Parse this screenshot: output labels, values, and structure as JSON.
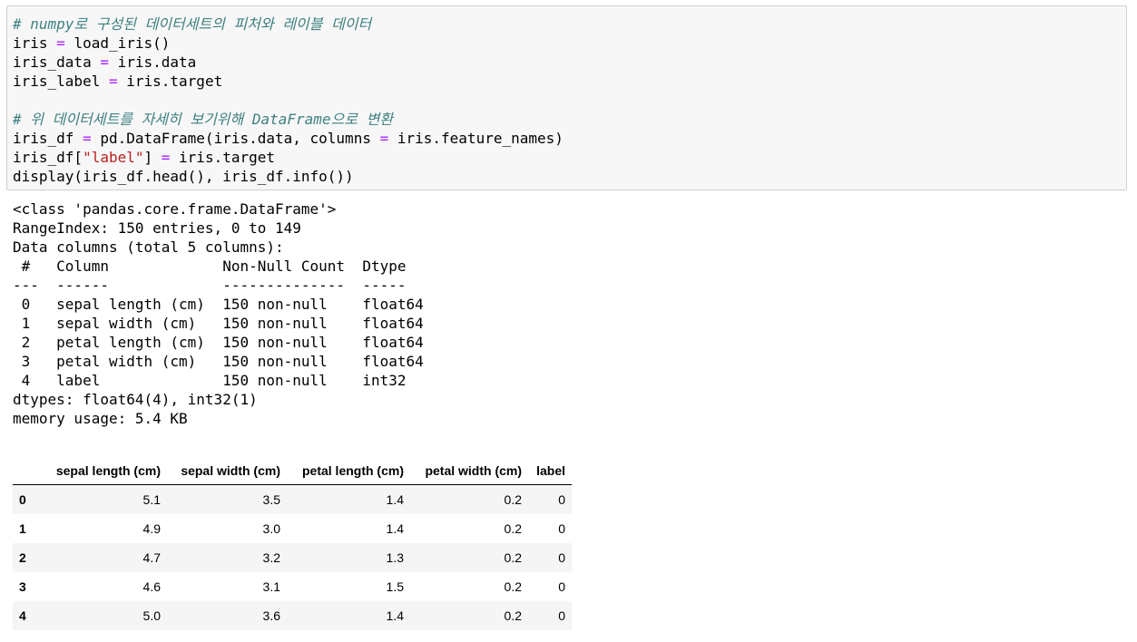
{
  "code_cell": {
    "lines": [
      {
        "comment": "# numpy로 구성된 데이터세트의 피처와 레이블 데이터"
      },
      {
        "a": "iris ",
        "op": "=",
        "b": " load_iris()"
      },
      {
        "a": "iris_data ",
        "op": "=",
        "b": " iris.data"
      },
      {
        "a": "iris_label ",
        "op": "=",
        "b": " iris.target"
      },
      {
        "comment": "# 위 데이터세트를 자세히 보기위해 DataFrame으로 변환"
      },
      {
        "a": "iris_df ",
        "op": "=",
        "b": " pd.DataFrame(iris.data, columns ",
        "op2": "=",
        "c": " iris.feature_names)"
      },
      {
        "a": "iris_df[",
        "str": "\"label\"",
        "b": "] ",
        "op": "=",
        "c": " iris.target"
      },
      {
        "text": "display(iris_df.head(), iris_df.info())"
      }
    ]
  },
  "output": {
    "info_lines": [
      "<class 'pandas.core.frame.DataFrame'>",
      "RangeIndex: 150 entries, 0 to 149",
      "Data columns (total 5 columns):",
      " #   Column             Non-Null Count  Dtype  ",
      "---  ------             --------------  -----  ",
      " 0   sepal length (cm)  150 non-null    float64",
      " 1   sepal width (cm)   150 non-null    float64",
      " 2   petal length (cm)  150 non-null    float64",
      " 3   petal width (cm)   150 non-null    float64",
      " 4   label              150 non-null    int32  ",
      "dtypes: float64(4), int32(1)",
      "memory usage: 5.4 KB"
    ],
    "table": {
      "columns": [
        "",
        "sepal length (cm)",
        "sepal width (cm)",
        "petal length (cm)",
        "petal width (cm)",
        "label"
      ],
      "rows": [
        [
          "0",
          "5.1",
          "3.5",
          "1.4",
          "0.2",
          "0"
        ],
        [
          "1",
          "4.9",
          "3.0",
          "1.4",
          "0.2",
          "0"
        ],
        [
          "2",
          "4.7",
          "3.2",
          "1.3",
          "0.2",
          "0"
        ],
        [
          "3",
          "4.6",
          "3.1",
          "1.5",
          "0.2",
          "0"
        ],
        [
          "4",
          "5.0",
          "3.6",
          "1.4",
          "0.2",
          "0"
        ]
      ]
    }
  }
}
